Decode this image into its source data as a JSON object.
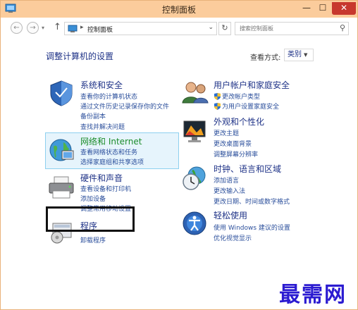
{
  "window": {
    "title": "控制面板"
  },
  "nav": {
    "breadcrumb": "控制面板",
    "search_placeholder": "搜索控制面板"
  },
  "heading": "调整计算机的设置",
  "view_by": {
    "label": "查看方式:",
    "value": "类别"
  },
  "categories": {
    "system_security": {
      "title": "系统和安全",
      "links": [
        "查看你的计算机状态",
        "通过文件历史记录保存你的文件",
        "备份副本",
        "查找并解决问题"
      ]
    },
    "network": {
      "title": "网络和 Internet",
      "links": [
        "查看网络状态和任务",
        "选择家庭组和共享选项"
      ]
    },
    "hardware": {
      "title": "硬件和声音",
      "links": [
        "查看设备和打印机",
        "添加设备",
        "调整常用移动设置"
      ]
    },
    "programs": {
      "title": "程序",
      "links": [
        "卸载程序"
      ]
    },
    "user_accounts": {
      "title": "用户帐户和家庭安全",
      "links": [
        "更改帐户类型",
        "为用户设置家庭安全"
      ]
    },
    "appearance": {
      "title": "外观和个性化",
      "links": [
        "更改主题",
        "更改桌面背景",
        "调整屏幕分辨率"
      ]
    },
    "clock": {
      "title": "时钟、语言和区域",
      "links": [
        "添加语言",
        "更改输入法",
        "更改日期、时间或数字格式"
      ]
    },
    "ease": {
      "title": "轻松使用",
      "links": [
        "使用 Windows 建议的设置",
        "优化视觉显示"
      ]
    }
  },
  "watermark": "最需网",
  "colors": {
    "titlebar": "#fbcc9c",
    "link": "#2a4e9b",
    "heading": "#1e3287",
    "close": "#c7382e"
  }
}
